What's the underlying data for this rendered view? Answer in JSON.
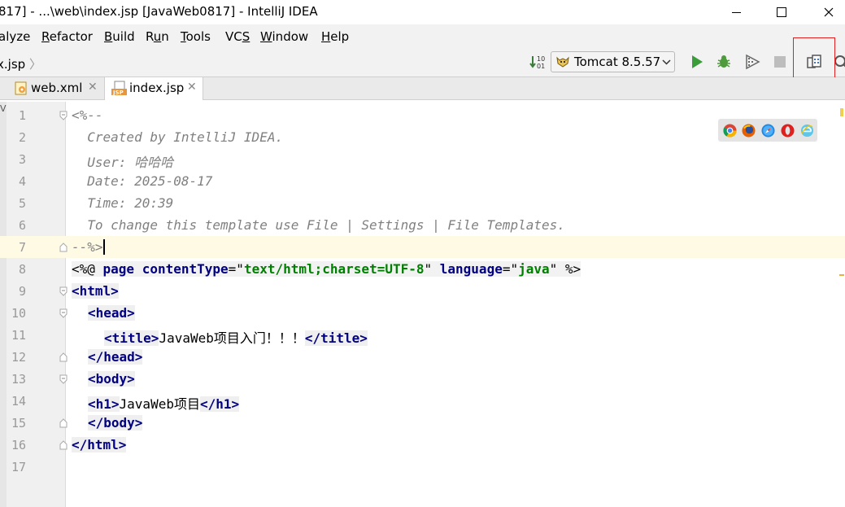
{
  "window": {
    "title": "817] - ...\\web\\index.jsp [JavaWeb0817] - IntelliJ IDEA",
    "minimize_icon": "minimize-icon",
    "maximize_icon": "maximize-icon",
    "close_icon": "close-icon"
  },
  "menu": [
    {
      "label": "alyze",
      "mnemonic": ""
    },
    {
      "label": "Refactor",
      "mnemonic": "R"
    },
    {
      "label": "Build",
      "mnemonic": "B"
    },
    {
      "label": "Run",
      "mnemonic": "u"
    },
    {
      "label": "Tools",
      "mnemonic": "T"
    },
    {
      "label": "VCS",
      "mnemonic": "S"
    },
    {
      "label": "Window",
      "mnemonic": "W"
    },
    {
      "label": "Help",
      "mnemonic": "H"
    }
  ],
  "navbar": {
    "breadcrumb": "x.jsp",
    "run_config": "Tomcat 8.5.57",
    "icons": [
      "sort-icon",
      "tomcat-icon",
      "run-icon",
      "debug-icon",
      "coverage-icon",
      "stop-icon",
      "project-structure-icon",
      "search-icon"
    ]
  },
  "tabs": [
    {
      "label": "web.xml",
      "icon": "xml-file-icon",
      "active": false
    },
    {
      "label": "index.jsp",
      "icon": "jsp-file-icon",
      "active": true
    }
  ],
  "editor": {
    "current_line": 7,
    "lines": [
      {
        "n": "1"
      },
      {
        "n": "2"
      },
      {
        "n": "3"
      },
      {
        "n": "4"
      },
      {
        "n": "5"
      },
      {
        "n": "6"
      },
      {
        "n": "7"
      },
      {
        "n": "8"
      },
      {
        "n": "9"
      },
      {
        "n": "10"
      },
      {
        "n": "11"
      },
      {
        "n": "12"
      },
      {
        "n": "13"
      },
      {
        "n": "14"
      },
      {
        "n": "15"
      },
      {
        "n": "16"
      },
      {
        "n": "17"
      }
    ],
    "code": {
      "l1": "<%--",
      "l2": "  Created by IntelliJ IDEA.",
      "l3": "  User: 哈哈哈",
      "l4": "  Date: 2025-08-17",
      "l5": "  Time: 20:39",
      "l6": "  To change this template use File | Settings | File Templates.",
      "l7": "--%>",
      "l8_a": "<%@ ",
      "l8_b": "page",
      "l8_c": " ",
      "l8_d": "contentType",
      "l8_e": "=\"",
      "l8_f": "text/html;charset=UTF-8",
      "l8_g": "\" ",
      "l8_h": "language",
      "l8_i": "=\"",
      "l8_j": "java",
      "l8_k": "\" %>",
      "l9": "<html>",
      "l10": "<head>",
      "l11_a": "<title>",
      "l11_b": "JavaWeb项目入门！！！",
      "l11_c": "</title>",
      "l12": "</head>",
      "l13": "<body>",
      "l14_a": "<h1>",
      "l14_b": "JavaWeb项目",
      "l14_c": "</h1>",
      "l15": "</body>",
      "l16": "</html>"
    }
  },
  "browser_icons": [
    "chrome-icon",
    "firefox-icon",
    "safari-icon",
    "opera-icon",
    "ie-icon"
  ],
  "colors": {
    "comment": "#808080",
    "tag": "#000080",
    "string": "#008000",
    "current_line": "#fffae3",
    "highlight_box": "#e02020"
  }
}
